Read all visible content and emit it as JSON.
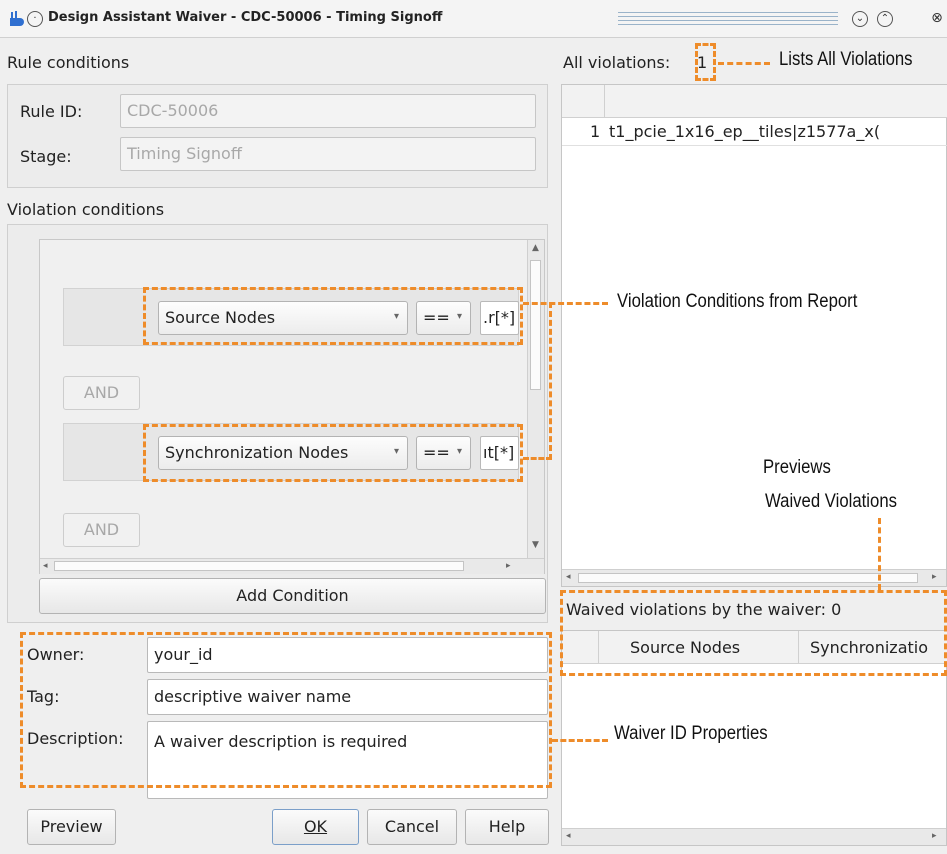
{
  "window": {
    "title": "Design Assistant Waiver - CDC-50006 - Timing Signoff",
    "buttons": [
      "minimize",
      "maximize",
      "close"
    ]
  },
  "rule_conditions": {
    "heading": "Rule conditions",
    "rule_id_label": "Rule ID:",
    "rule_id_value": "CDC-50006",
    "stage_label": "Stage:",
    "stage_value": "Timing Signoff"
  },
  "violation_conditions": {
    "heading": "Violation conditions",
    "conditions": [
      {
        "field": "Source Nodes",
        "operator": "==",
        "value": ".r[*]"
      },
      {
        "field": "Synchronization Nodes",
        "operator": "==",
        "value": "ıt[*]"
      }
    ],
    "and_label": "AND",
    "add_condition_label": "Add Condition"
  },
  "properties": {
    "owner_label": "Owner:",
    "owner_value": "your_id",
    "tag_label": "Tag:",
    "tag_value": "descriptive waiver name",
    "description_label": "Description:",
    "description_value": "A waiver description is required"
  },
  "bottom_buttons": {
    "preview": "Preview",
    "ok": "OK",
    "cancel": "Cancel",
    "help": "Help"
  },
  "all_violations": {
    "label": "All violations:",
    "count": "1",
    "rows": [
      {
        "index": "1",
        "value": "t1_pcie_1x16_ep__tiles|z1577a_x("
      }
    ]
  },
  "waived": {
    "label": "Waived violations by the waiver: 0",
    "columns": [
      "Source Nodes",
      "Synchronizatio"
    ]
  },
  "annotations": {
    "lists_all": "Lists All Violations",
    "violation_conditions": "Violation Conditions from Report",
    "previews_line1": "Previews",
    "previews_line2": "Waived Violations",
    "waiver_id": "Waiver ID Properties"
  },
  "colors": {
    "annotation": "#ee8c2a",
    "window_bg": "#efefef",
    "panel_bg": "#ffffff"
  }
}
